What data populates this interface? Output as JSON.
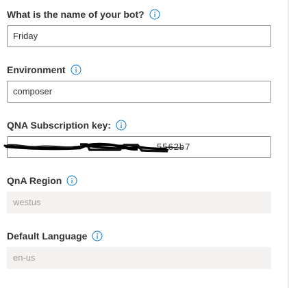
{
  "fields": {
    "bot_name": {
      "label": "What is the name of your bot?",
      "value": "Friday",
      "has_info_icon": true,
      "disabled": false
    },
    "environment": {
      "label": "Environment",
      "value": "composer",
      "has_info_icon": true,
      "disabled": false
    },
    "qna_key": {
      "label": "QNA Subscription key:",
      "value": "",
      "value_redacted": true,
      "visible_key_fragment": "5562b7",
      "has_info_icon": true,
      "disabled": false
    },
    "qna_region": {
      "label": "QnA Region",
      "value": "westus",
      "has_info_icon": true,
      "disabled": true
    },
    "default_language": {
      "label": "Default Language",
      "value": "en-us",
      "has_info_icon": true,
      "disabled": true
    }
  },
  "colors": {
    "label": "#323130",
    "info_icon": "#0078d4",
    "input_border": "#8a8886",
    "disabled_bg": "#f3f2f1",
    "disabled_text": "#a19f9d",
    "redaction": "#000000"
  },
  "icons": {
    "info": "info-circle-icon"
  }
}
